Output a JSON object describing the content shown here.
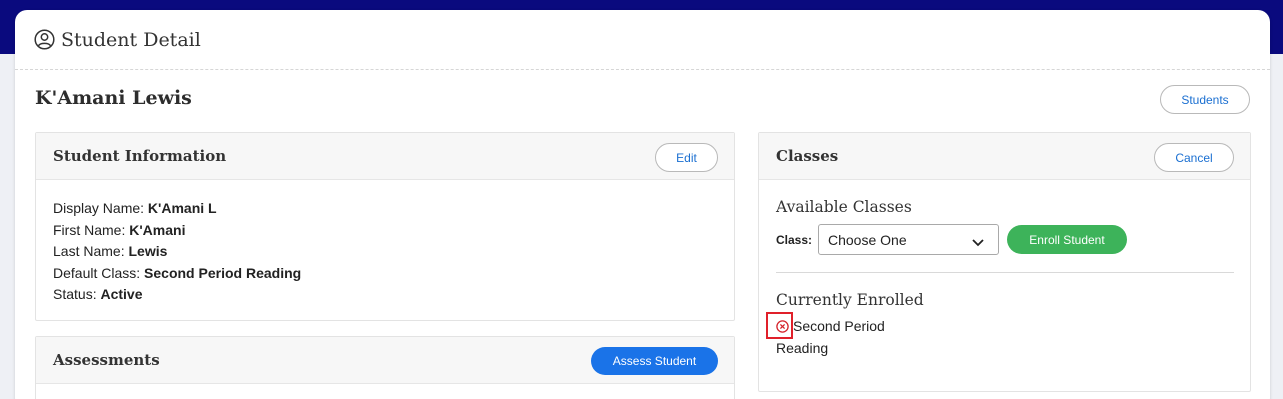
{
  "header": {
    "title": "Student Detail"
  },
  "student": {
    "name": "K'Amani Lewis"
  },
  "buttons": {
    "students": "Students",
    "edit": "Edit",
    "cancel": "Cancel",
    "assess": "Assess Student",
    "enroll": "Enroll Student"
  },
  "student_info": {
    "title": "Student Information",
    "fields": [
      {
        "label": "Display Name: ",
        "value": "K'Amani L"
      },
      {
        "label": "First Name: ",
        "value": "K'Amani"
      },
      {
        "label": "Last Name: ",
        "value": "Lewis"
      },
      {
        "label": "Default Class: ",
        "value": "Second Period Reading"
      },
      {
        "label": "Status: ",
        "value": "Active"
      }
    ]
  },
  "assessments": {
    "title": "Assessments"
  },
  "classes": {
    "title": "Classes",
    "available_title": "Available Classes",
    "class_label": "Class:",
    "select_value": "Choose One",
    "enrolled_title": "Currently Enrolled",
    "enrolled": [
      {
        "name": "Second Period Reading"
      }
    ]
  },
  "icons": {
    "header": "user-circle-icon",
    "remove": "remove-circle-x-icon",
    "dropdown": "chevron-down-icon"
  },
  "colors": {
    "top_band": "#0a0a7e",
    "primary_blue": "#1a73e8",
    "enroll_green": "#3db35a",
    "remove_red": "#e0202a"
  }
}
